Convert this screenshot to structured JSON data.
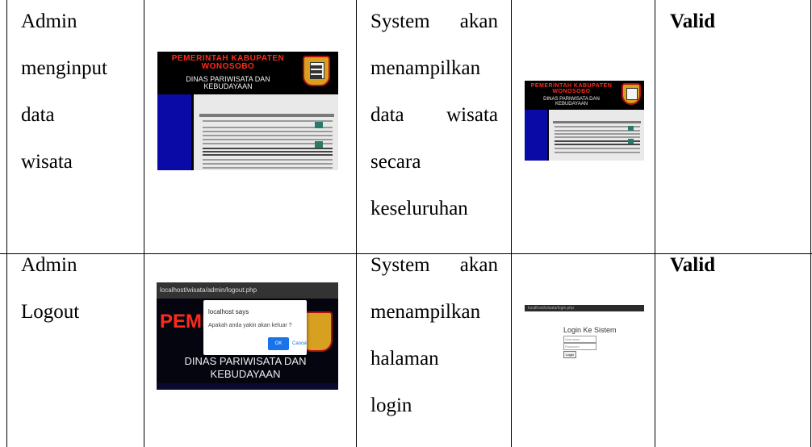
{
  "rows": [
    {
      "actor_lines": [
        "Admin",
        "menginput",
        "data",
        "wisata"
      ],
      "expected_lines": [
        [
          "System",
          "akan"
        ],
        [
          "menampilkan"
        ],
        [
          "data",
          "wisata"
        ],
        [
          "secara"
        ],
        [
          "keseluruhan"
        ]
      ],
      "result": "Valid",
      "input_screenshot": {
        "title1": "PEMERINTAH KABUPATEN",
        "title2": "WONOSOBO",
        "subtitle1": "DINAS PARIWISATA DAN",
        "subtitle2": "KEBUDAYAAN"
      },
      "output_screenshot": {
        "title1": "PEMERINTAH KABUPATEN",
        "title2": "WONOSOBO",
        "subtitle1": "DINAS PARIWISATA DAN",
        "subtitle2": "KEBUDAYAAN"
      }
    },
    {
      "actor_lines": [
        "Admin",
        "Logout"
      ],
      "expected_lines": [
        [
          "System",
          "akan"
        ],
        [
          "menampilkan"
        ],
        [
          "halaman"
        ],
        [
          "login"
        ]
      ],
      "result": "Valid",
      "input_screenshot": {
        "url": "localhost/wisata/admin/logout.php",
        "bg_title": "PEMEI",
        "bg_subtitle1": "DINAS PARIWISATA DAN",
        "bg_subtitle2": "KEBUDAYAAN",
        "dialog_title": "localhost says",
        "dialog_message": "Apakah anda yakin akan keluar ?",
        "ok_label": "OK",
        "cancel_label": "Cancel"
      },
      "output_screenshot": {
        "url": "localhost/wisata/login.php",
        "heading": "Login Ke Sistem",
        "username_placeholder": "Username",
        "password_placeholder": "Password",
        "login_label": "Login"
      }
    }
  ],
  "colors": {
    "border": "#000000",
    "banner_red": "#ff2a1a",
    "sidebar_blue": "#0a0aa6",
    "dialog_ok_blue": "#1a73e8"
  }
}
